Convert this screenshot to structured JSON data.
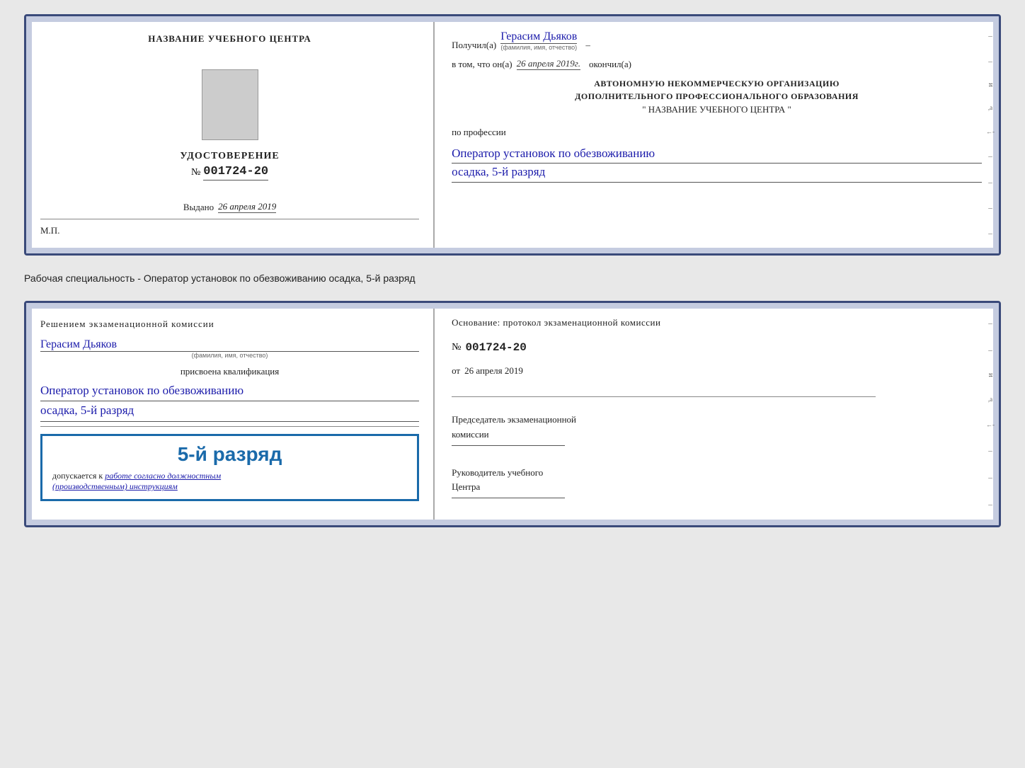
{
  "page": {
    "background": "#e8e8e8"
  },
  "top_cert": {
    "left": {
      "center_title": "НАЗВАНИЕ УЧЕБНОГО ЦЕНТРА",
      "udostoverenie": "УДОСТОВЕРЕНИЕ",
      "number_prefix": "№",
      "number": "001724-20",
      "vydano_label": "Выдано",
      "vydano_date": "26 апреля 2019",
      "mp": "М.П."
    },
    "right": {
      "poluchil_label": "Получил(а)",
      "recipient_name": "Герасим Дьяков",
      "fio_note": "(фамилия, имя, отчество)",
      "dash": "–",
      "vtom_label": "в том, что он(а)",
      "date_value": "26 апреля 2019г.",
      "okончил_label": "окончил(а)",
      "org_line1": "АВТОНОМНУЮ НЕКОММЕРЧЕСКУЮ ОРГАНИЗАЦИЮ",
      "org_line2": "ДОПОЛНИТЕЛЬНОГО ПРОФЕССИОНАЛЬНОГО ОБРАЗОВАНИЯ",
      "org_quote": "\"   НАЗВАНИЕ УЧЕБНОГО ЦЕНТРА   \"",
      "po_professii": "по профессии",
      "profession1": "Оператор установок по обезвоживанию",
      "profession2": "осадка, 5-й разряд"
    }
  },
  "separator": {
    "text": "Рабочая специальность - Оператор установок по обезвоживанию осадка, 5-й разряд"
  },
  "bottom_cert": {
    "left": {
      "resheniem": "Решением экзаменационной комиссии",
      "name": "Герасим Дьяков",
      "fio_note": "(фамилия, имя, отчество)",
      "prisvoena": "присвоена квалификация",
      "qualification1": "Оператор установок по обезвоживанию",
      "qualification2": "осадка, 5-й разряд",
      "razryad_box_text": "5-й разряд",
      "dopuskaetsya_prefix": "допускается к",
      "dopuskaetsya_link": "работе согласно должностным",
      "dopuskaetsya_suffix": "(производственным) инструкциям"
    },
    "right": {
      "osnov_label": "Основание: протокол экзаменационной комиссии",
      "number_prefix": "№",
      "protocol_num": "001724-20",
      "ot_label": "от",
      "ot_date": "26 апреля 2019",
      "predsedatel_label": "Председатель экзаменационной",
      "predsedatel_label2": "комиссии",
      "rukovoditel_label": "Руководитель учебного",
      "rukovoditel_label2": "Центра"
    }
  }
}
